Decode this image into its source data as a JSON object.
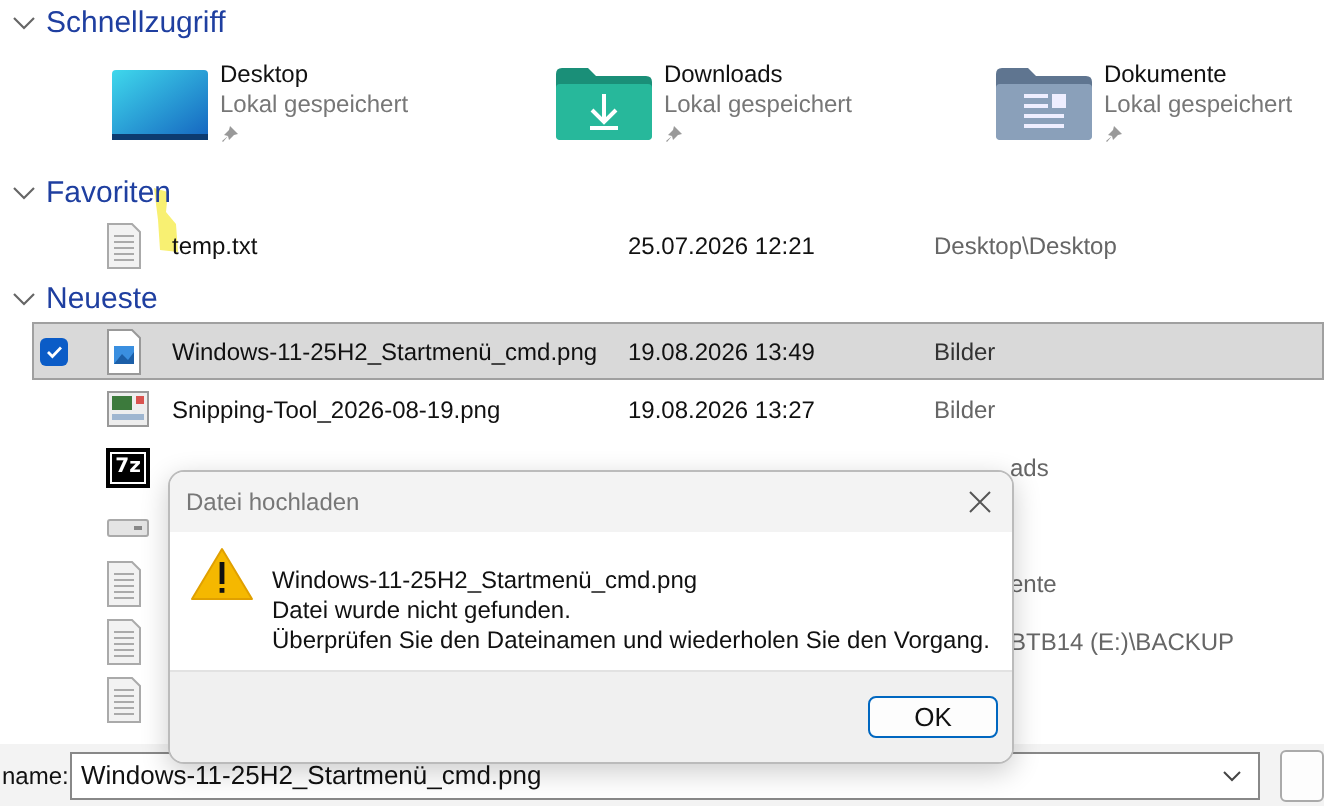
{
  "quick_access": {
    "title": "Schnellzugriff",
    "expanded": true,
    "items": [
      {
        "name": "Desktop",
        "status": "Lokal gespeichert",
        "kind": "desktop",
        "pinned": true
      },
      {
        "name": "Downloads",
        "status": "Lokal gespeichert",
        "kind": "downloads",
        "pinned": true
      },
      {
        "name": "Dokumente",
        "status": "Lokal gespeichert",
        "kind": "documents",
        "pinned": true
      }
    ]
  },
  "favorites": {
    "title": "Favoriten",
    "expanded": true,
    "items": [
      {
        "name": "temp.txt",
        "date": "25.07.2026 12:21",
        "location": "Desktop\\Desktop",
        "kind": "text",
        "selected": false
      }
    ]
  },
  "recent": {
    "title": "Neueste",
    "expanded": true,
    "items": [
      {
        "name": "Windows-11-25H2_Startmenü_cmd.png",
        "date": "19.08.2026 13:49",
        "location": "Bilder",
        "kind": "image",
        "selected": true
      },
      {
        "name": "Snipping-Tool_2026-08-19.png",
        "date": "19.08.2026 13:27",
        "location": "Bilder",
        "kind": "screenshot",
        "selected": false
      },
      {
        "location": "ads",
        "kind": "archive",
        "badge": "7z",
        "selected": false
      },
      {
        "kind": "drive",
        "selected": false
      },
      {
        "location": "ente",
        "kind": "text",
        "selected": false
      },
      {
        "location": "BTB14 (E:)\\BACKUP",
        "kind": "text",
        "selected": false
      },
      {
        "kind": "text",
        "selected": false
      }
    ]
  },
  "filename_bar": {
    "label": "name:",
    "value": "Windows-11-25H2_Startmenü_cmd.png"
  },
  "dialog": {
    "title": "Datei hochladen",
    "lines": [
      "Windows-11-25H2_Startmenü_cmd.png",
      "Datei wurde nicht gefunden.",
      "Überprüfen Sie den Dateinamen und wiederholen Sie den Vorgang."
    ],
    "button": "OK"
  }
}
